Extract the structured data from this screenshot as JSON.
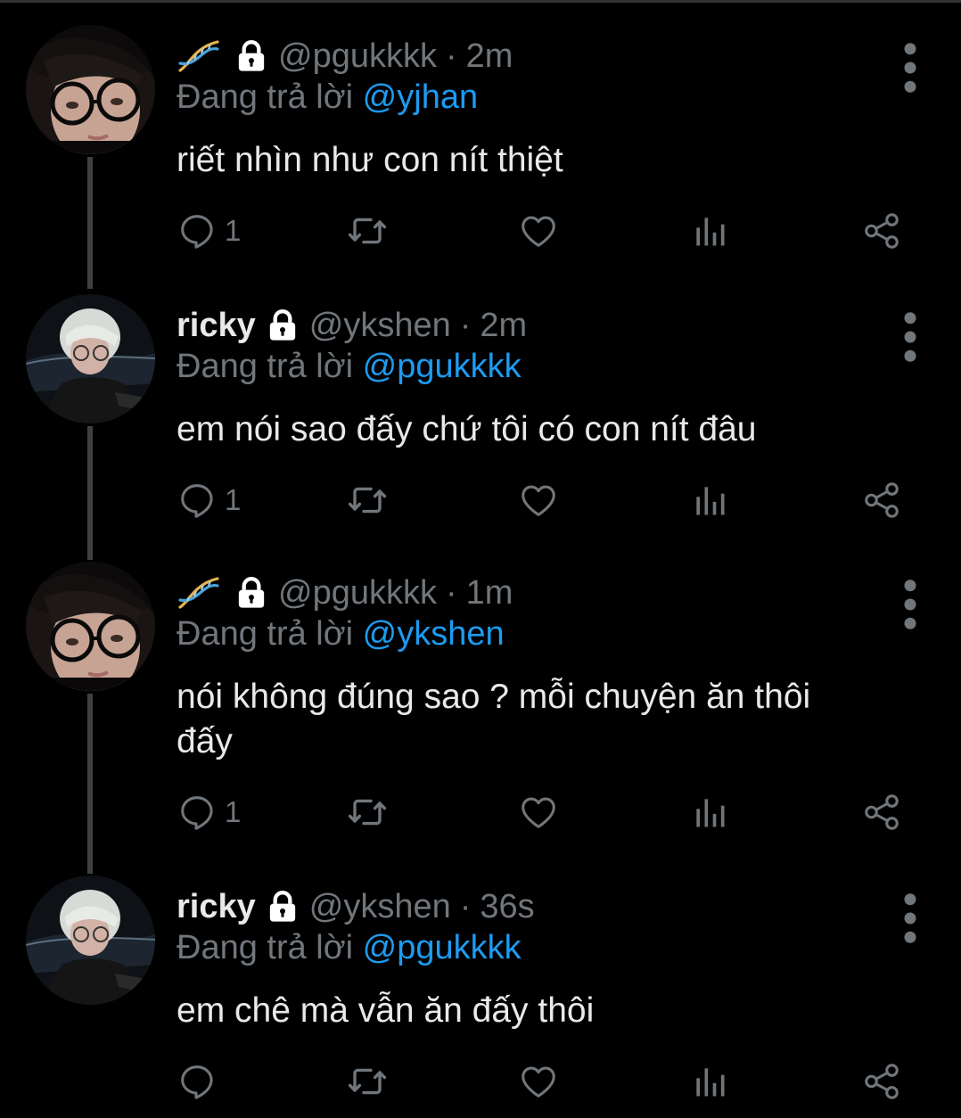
{
  "tweets": [
    {
      "display_name": "",
      "handle": "@pgukkkk",
      "separator": "·",
      "time": "2m",
      "replying_prefix": "Đang trả lời",
      "replying_to": "@yjhan",
      "text": "riết nhìn như con nít thiệt",
      "reply_count": "1",
      "badge_icon": "dna-emoji-icon"
    },
    {
      "display_name": "ricky",
      "handle": "@ykshen",
      "separator": "·",
      "time": "2m",
      "replying_prefix": "Đang trả lời",
      "replying_to": "@pgukkkk",
      "text": "em nói sao đấy chứ tôi có con nít đâu",
      "reply_count": "1"
    },
    {
      "display_name": "",
      "handle": "@pgukkkk",
      "separator": "·",
      "time": "1m",
      "replying_prefix": "Đang trả lời",
      "replying_to": "@ykshen",
      "text_line1": "nói không đúng sao ? mỗi chuyện ăn thôi",
      "text_line2": "đấy",
      "reply_count": "1",
      "badge_icon": "dna-emoji-icon"
    },
    {
      "display_name": "ricky",
      "handle": "@ykshen",
      "separator": "·",
      "time": "36s",
      "replying_prefix": "Đang trả lời",
      "replying_to": "@pgukkkk",
      "text": "em chê mà vẫn ăn đấy thôi",
      "reply_count": ""
    }
  ],
  "colors": {
    "background": "#000000",
    "text": "#e7e9ea",
    "muted": "#71767b",
    "mention": "#1d9bf0",
    "thread_line": "#3e4144"
  },
  "icons": [
    "reply-icon",
    "retweet-icon",
    "like-icon",
    "views-icon",
    "share-icon",
    "more-icon",
    "lock-icon"
  ]
}
